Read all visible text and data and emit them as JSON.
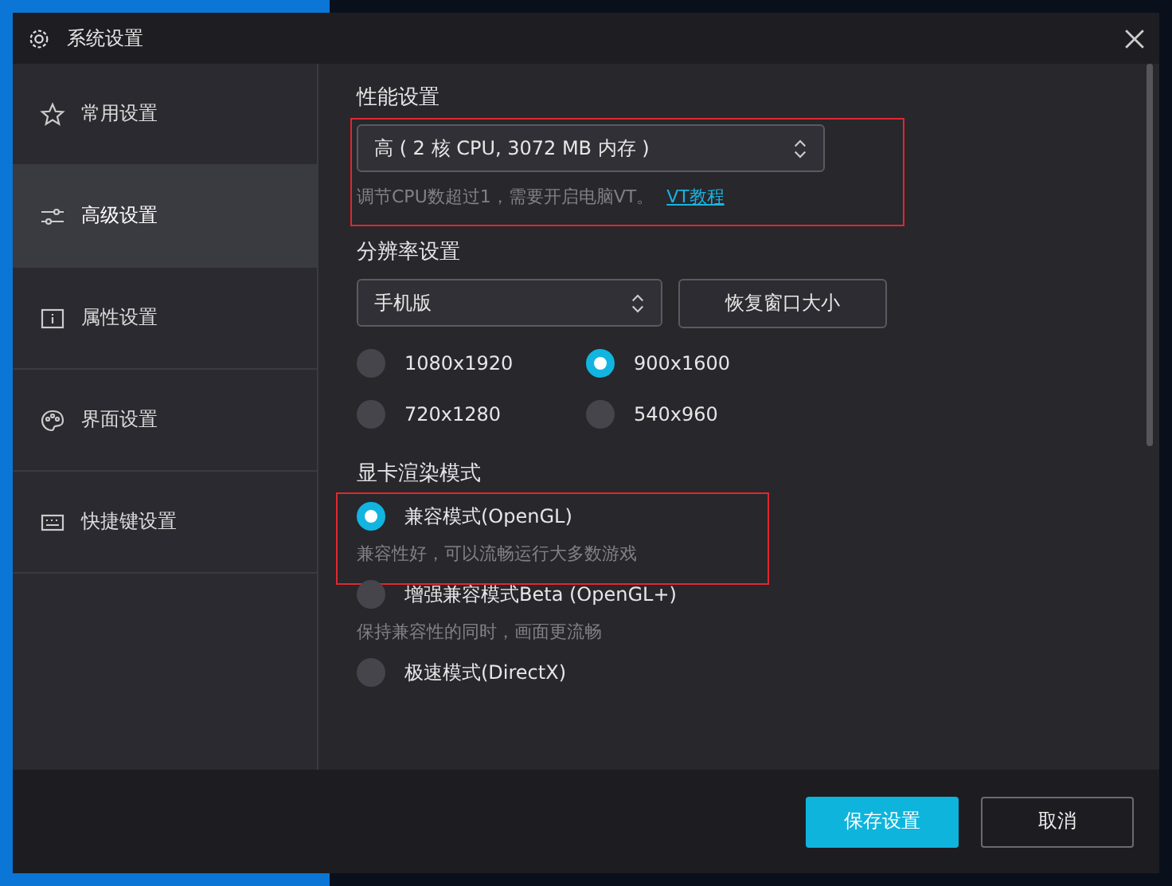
{
  "window": {
    "title": "系统设置"
  },
  "sidebar": {
    "items": [
      {
        "label": "常用设置",
        "selected": false
      },
      {
        "label": "高级设置",
        "selected": true
      },
      {
        "label": "属性设置",
        "selected": false
      },
      {
        "label": "界面设置",
        "selected": false
      },
      {
        "label": "快捷键设置",
        "selected": false
      }
    ]
  },
  "performance": {
    "heading": "性能设置",
    "highlighted": true,
    "select_value": "高 ( 2 核 CPU, 3072 MB 内存 )",
    "hint": "调节CPU数超过1，需要开启电脑VT。",
    "link": "VT教程"
  },
  "resolution": {
    "heading": "分辨率设置",
    "select_value": "手机版",
    "restore_button": "恢复窗口大小",
    "options": [
      {
        "label": "1080x1920",
        "selected": false
      },
      {
        "label": "900x1600",
        "selected": true
      },
      {
        "label": "720x1280",
        "selected": false
      },
      {
        "label": "540x960",
        "selected": false
      }
    ]
  },
  "render_mode": {
    "heading": "显卡渲染模式",
    "options": [
      {
        "label": "兼容模式(OpenGL)",
        "description": "兼容性好，可以流畅运行大多数游戏",
        "selected": true,
        "highlighted": true
      },
      {
        "label": "增强兼容模式Beta (OpenGL+)",
        "description": "保持兼容性的同时，画面更流畅",
        "selected": false,
        "highlighted": false
      },
      {
        "label": "极速模式(DirectX)",
        "selected": false,
        "highlighted": false
      }
    ]
  },
  "footer": {
    "save_button": "保存设置",
    "cancel_button": "取消"
  }
}
